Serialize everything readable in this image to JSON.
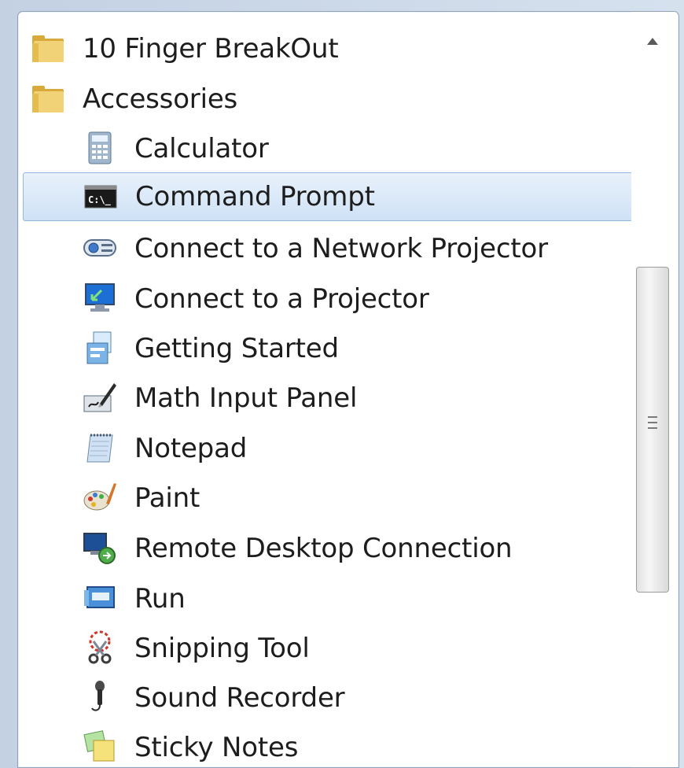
{
  "menu": {
    "items": [
      {
        "label": "10 Finger BreakOut",
        "icon": "folder-icon",
        "kind": "folder",
        "name": "menu-folder-10-finger-breakout"
      },
      {
        "label": "Accessories",
        "icon": "folder-icon",
        "kind": "folder",
        "name": "menu-folder-accessories"
      },
      {
        "label": "Calculator",
        "icon": "calculator-icon",
        "kind": "app",
        "name": "menu-item-calculator"
      },
      {
        "label": "Command Prompt",
        "icon": "command-prompt-icon",
        "kind": "app",
        "name": "menu-item-command-prompt",
        "selected": true
      },
      {
        "label": "Connect to a Network Projector",
        "icon": "network-projector-icon",
        "kind": "app",
        "name": "menu-item-connect-network-projector"
      },
      {
        "label": "Connect to a Projector",
        "icon": "projector-monitor-icon",
        "kind": "app",
        "name": "menu-item-connect-projector"
      },
      {
        "label": "Getting Started",
        "icon": "getting-started-icon",
        "kind": "app",
        "name": "menu-item-getting-started"
      },
      {
        "label": "Math Input Panel",
        "icon": "math-input-pen-icon",
        "kind": "app",
        "name": "menu-item-math-input-panel"
      },
      {
        "label": "Notepad",
        "icon": "notepad-icon",
        "kind": "app",
        "name": "menu-item-notepad"
      },
      {
        "label": "Paint",
        "icon": "paint-palette-icon",
        "kind": "app",
        "name": "menu-item-paint"
      },
      {
        "label": "Remote Desktop Connection",
        "icon": "remote-desktop-icon",
        "kind": "app",
        "name": "menu-item-remote-desktop"
      },
      {
        "label": "Run",
        "icon": "run-icon",
        "kind": "app",
        "name": "menu-item-run"
      },
      {
        "label": "Snipping Tool",
        "icon": "scissors-icon",
        "kind": "app",
        "name": "menu-item-snipping-tool"
      },
      {
        "label": "Sound Recorder",
        "icon": "microphone-icon",
        "kind": "app",
        "name": "menu-item-sound-recorder"
      },
      {
        "label": "Sticky Notes",
        "icon": "sticky-notes-icon",
        "kind": "app",
        "name": "menu-item-sticky-notes"
      }
    ]
  },
  "scrollbar": {
    "up_icon": "scroll-up-arrow-icon",
    "grip_icon": "scroll-grip-icon"
  },
  "colors": {
    "selection_fill": "#cfe2f6",
    "selection_border": "#93b8e2",
    "folder_yellow": "#e8c45a",
    "text": "#1d1d1d"
  }
}
